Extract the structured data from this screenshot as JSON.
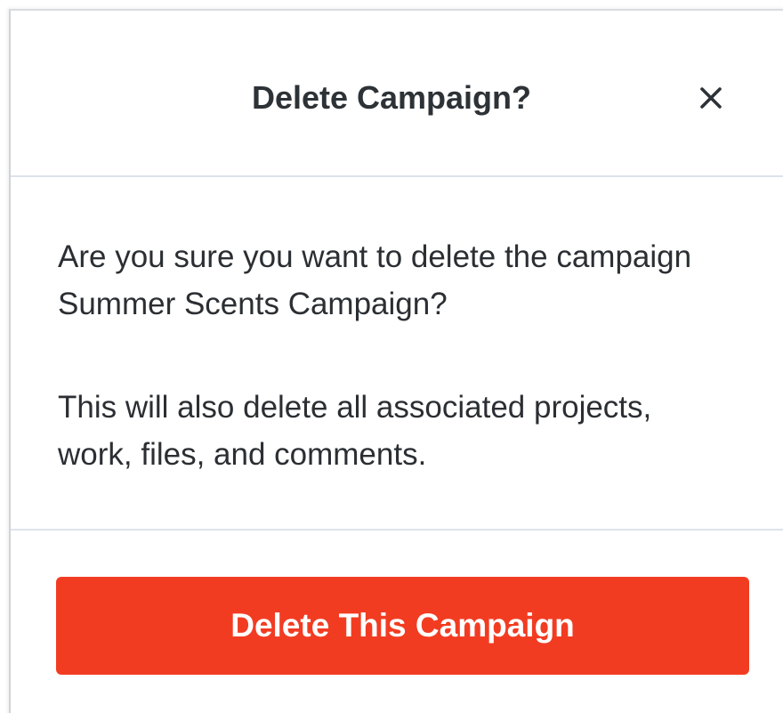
{
  "modal": {
    "title": "Delete Campaign?",
    "close_icon": "close-icon",
    "body": {
      "line1": "Are you sure you want to delete the campaign Summer Scents Campaign?",
      "line2": "This will also delete all associated projects, work, files, and comments."
    },
    "footer": {
      "delete_label": "Delete This Campaign"
    }
  },
  "colors": {
    "danger": "#f23c22",
    "text": "#2b2f33",
    "divider": "#dde3ea"
  }
}
